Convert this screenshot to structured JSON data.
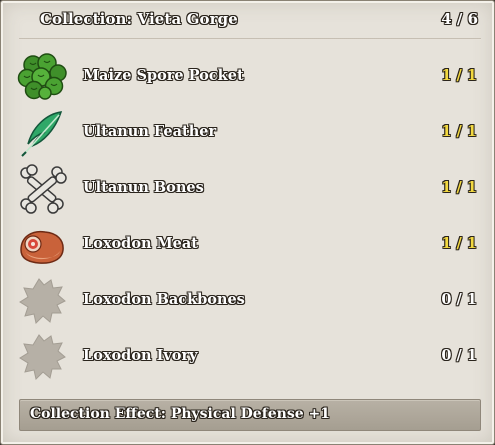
{
  "header": {
    "title": "Collection: Vieta Gorge",
    "count": "4 / 6"
  },
  "items": [
    {
      "name": "Maize Spore Pocket",
      "progress": "1 / 1",
      "completed": true,
      "icon": "spore-pocket-icon"
    },
    {
      "name": "Ultanun Feather",
      "progress": "1 / 1",
      "completed": true,
      "icon": "feather-icon"
    },
    {
      "name": "Ultanun Bones",
      "progress": "1 / 1",
      "completed": true,
      "icon": "bones-icon"
    },
    {
      "name": "Loxodon Meat",
      "progress": "1 / 1",
      "completed": true,
      "icon": "meat-icon"
    },
    {
      "name": "Loxodon Backbones",
      "progress": "0 / 1",
      "completed": false,
      "icon": "unknown-item-icon"
    },
    {
      "name": "Loxodon Ivory",
      "progress": "0 / 1",
      "completed": false,
      "icon": "unknown-item-icon"
    }
  ],
  "footer": {
    "effect": "Collection Effect: Physical Defense +1"
  },
  "colors": {
    "completed": "#f2d840",
    "incomplete": "#ffffff",
    "panel": "#e6e2da"
  }
}
